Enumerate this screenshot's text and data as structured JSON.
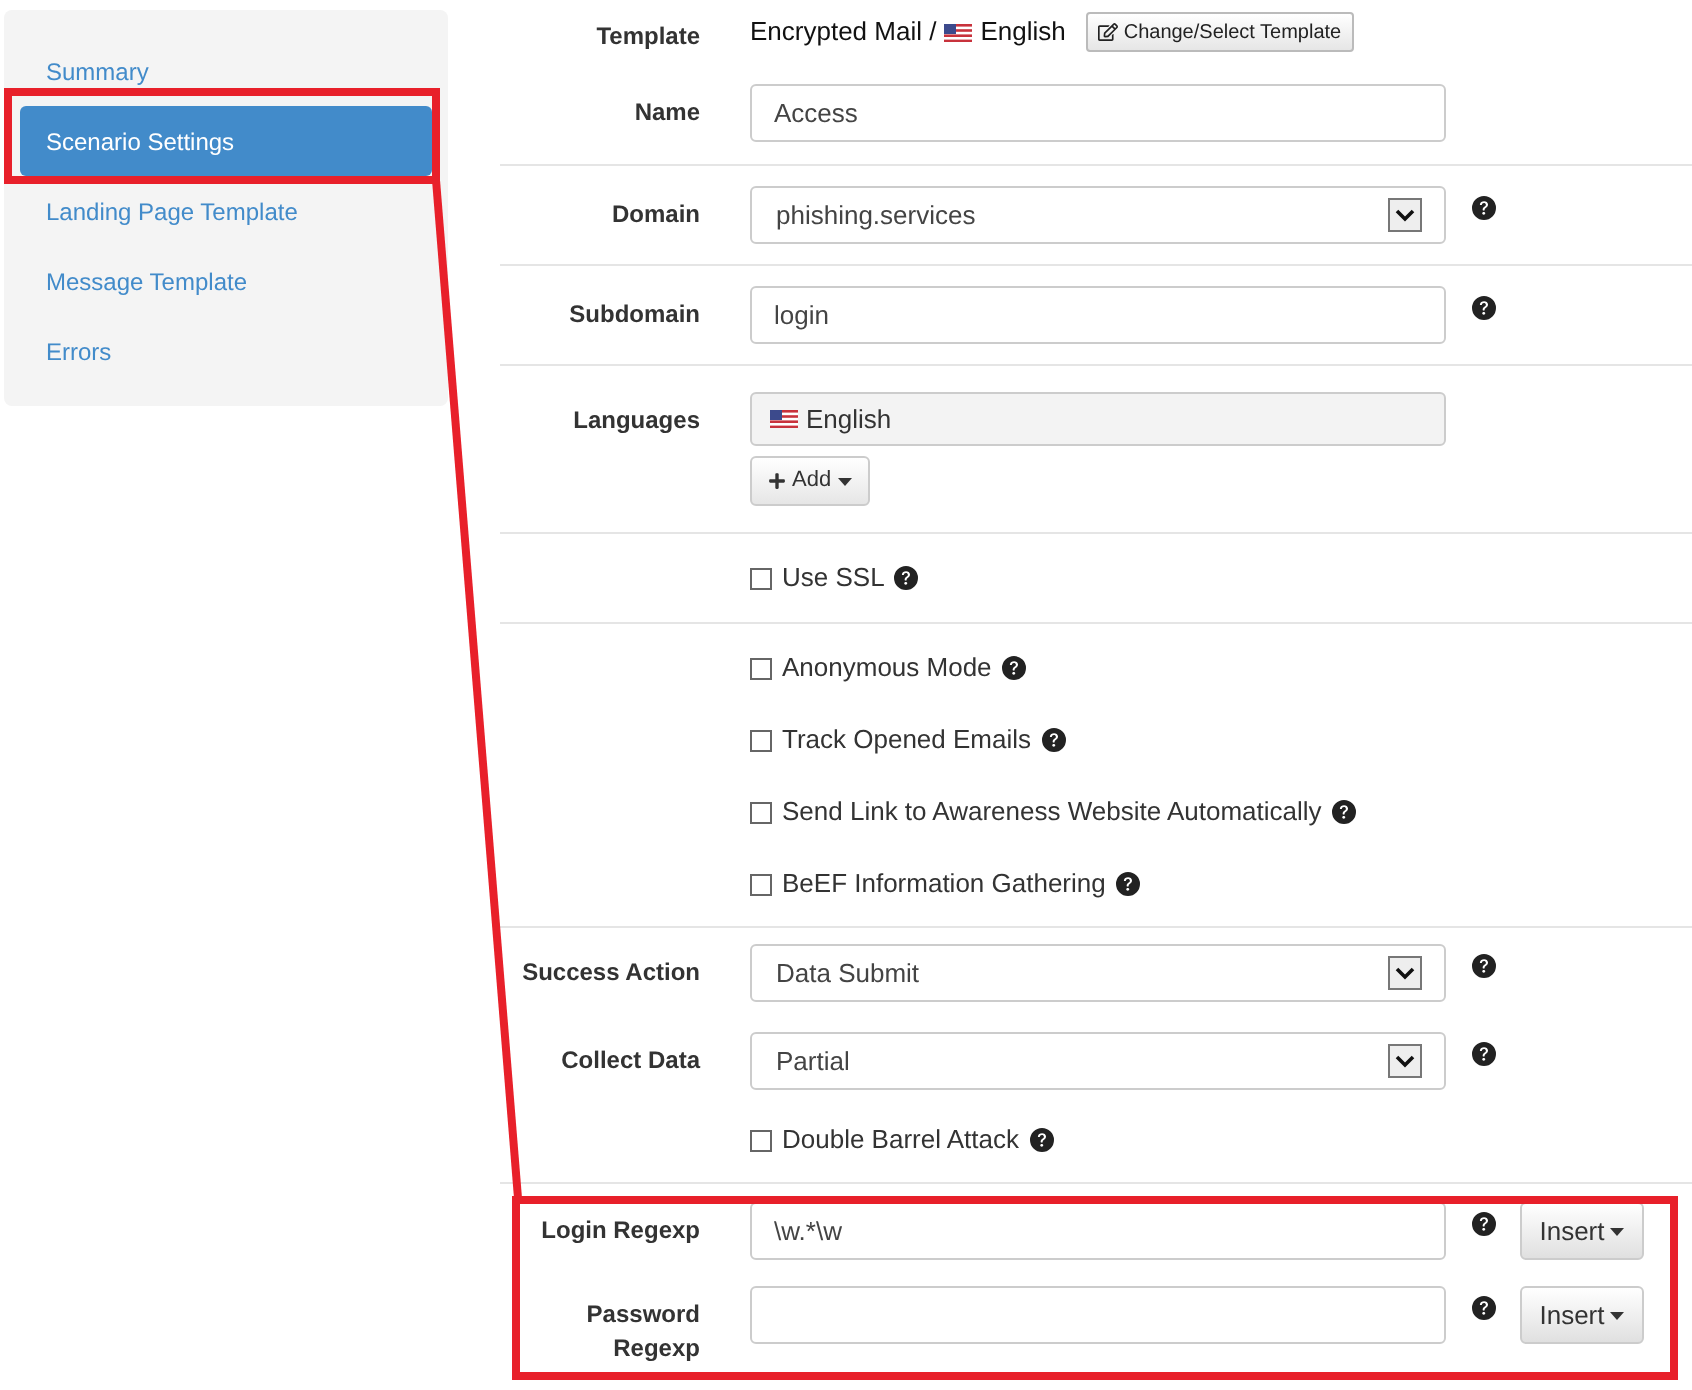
{
  "sidebar": {
    "items": [
      {
        "label": "Summary",
        "selected": false
      },
      {
        "label": "Scenario Settings",
        "selected": true
      },
      {
        "label": "Landing Page Template",
        "selected": false
      },
      {
        "label": "Message Template",
        "selected": false
      },
      {
        "label": "Errors",
        "selected": false
      }
    ]
  },
  "sections": [
    {
      "rows": [
        {
          "kind": "template",
          "label": "Template",
          "value": "Encrypted Mail /",
          "language": "English",
          "button": "Change/Select Template"
        },
        {
          "kind": "text",
          "label": "Name",
          "value": "Access",
          "help": false
        }
      ]
    },
    {
      "rows": [
        {
          "kind": "select",
          "label": "Domain",
          "value": "phishing.services",
          "help": true
        }
      ]
    },
    {
      "rows": [
        {
          "kind": "text",
          "label": "Subdomain",
          "value": "login",
          "help": true
        }
      ]
    },
    {
      "rows": [
        {
          "kind": "languages",
          "label": "Languages",
          "tags": [
            {
              "label": "English"
            }
          ],
          "add_button": "Add"
        }
      ]
    },
    {
      "rows": [
        {
          "kind": "checkbox",
          "label": "Use SSL",
          "checked": false,
          "help": true
        }
      ]
    },
    {
      "rows": [
        {
          "kind": "checkbox",
          "label": "Anonymous Mode",
          "checked": false,
          "help": true
        },
        {
          "kind": "checkbox",
          "label": "Track Opened Emails",
          "checked": false,
          "help": true
        },
        {
          "kind": "checkbox",
          "label": "Send Link to Awareness Website Automatically",
          "checked": false,
          "help": true
        },
        {
          "kind": "checkbox",
          "label": "BeEF Information Gathering",
          "checked": false,
          "help": true
        }
      ]
    },
    {
      "rows": [
        {
          "kind": "select",
          "label": "Success Action",
          "value": "Data Submit",
          "help": true
        },
        {
          "kind": "select",
          "label": "Collect Data",
          "value": "Partial",
          "help": true
        },
        {
          "kind": "checkbox",
          "label": "Double Barrel Attack",
          "checked": false,
          "help": true
        }
      ]
    },
    {
      "rows": [
        {
          "kind": "text",
          "label": "Login Regexp",
          "value": "\\w.*\\w",
          "help": true,
          "insert_button": "Insert"
        },
        {
          "kind": "text",
          "label": "Password Regexp",
          "help": true,
          "insert_button": "Insert"
        }
      ]
    }
  ]
}
